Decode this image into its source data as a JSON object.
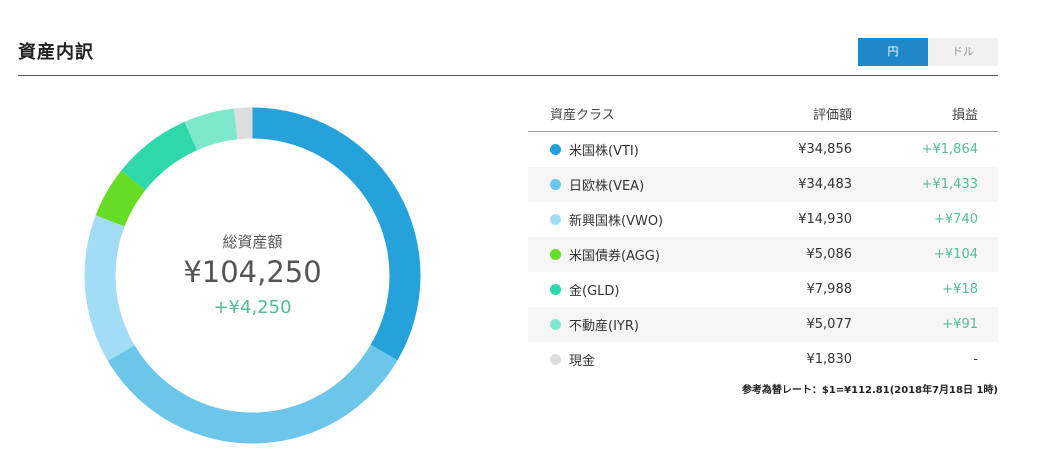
{
  "header": {
    "title": "資産内訳",
    "toggle": {
      "yen_label": "円",
      "dollar_label": "ドル"
    }
  },
  "summary": {
    "label": "総資産額",
    "total": "¥104,250",
    "gain": "+¥4,250"
  },
  "table": {
    "headers": {
      "asset_class": "資産クラス",
      "valuation": "評価額",
      "profit": "損益"
    },
    "rows": [
      {
        "name": "米国株(VTI)",
        "value": "¥34,856",
        "gain": "+¥1,864",
        "color": "#26a2db",
        "gain_type": "pos"
      },
      {
        "name": "日欧株(VEA)",
        "value": "¥34,483",
        "gain": "+¥1,433",
        "color": "#6bc6e9",
        "gain_type": "pos"
      },
      {
        "name": "新興国株(VWO)",
        "value": "¥14,930",
        "gain": "+¥740",
        "color": "#a3dcf7",
        "gain_type": "pos"
      },
      {
        "name": "米国債券(AGG)",
        "value": "¥5,086",
        "gain": "+¥104",
        "color": "#66dd22",
        "gain_type": "pos"
      },
      {
        "name": "金(GLD)",
        "value": "¥7,988",
        "gain": "+¥18",
        "color": "#2fd8aa",
        "gain_type": "pos"
      },
      {
        "name": "不動産(IYR)",
        "value": "¥5,077",
        "gain": "+¥91",
        "color": "#7ee8cc",
        "gain_type": "pos"
      },
      {
        "name": "現金",
        "value": "¥1,830",
        "gain": "-",
        "color": "#dddddd",
        "gain_type": "neutral"
      }
    ]
  },
  "footnote": "参考為替レート：$1=¥112.81(2018年7月18日 1時)",
  "chart_data": {
    "type": "pie",
    "donut": true,
    "categories": [
      "米国株(VTI)",
      "日欧株(VEA)",
      "新興国株(VWO)",
      "米国債券(AGG)",
      "金(GLD)",
      "不動産(IYR)",
      "現金"
    ],
    "values": [
      34856,
      34483,
      14930,
      5086,
      7988,
      5077,
      1830
    ],
    "colors": [
      "#26a2db",
      "#6bc6e9",
      "#a3dcf7",
      "#66dd22",
      "#2fd8aa",
      "#7ee8cc",
      "#dddddd"
    ]
  }
}
